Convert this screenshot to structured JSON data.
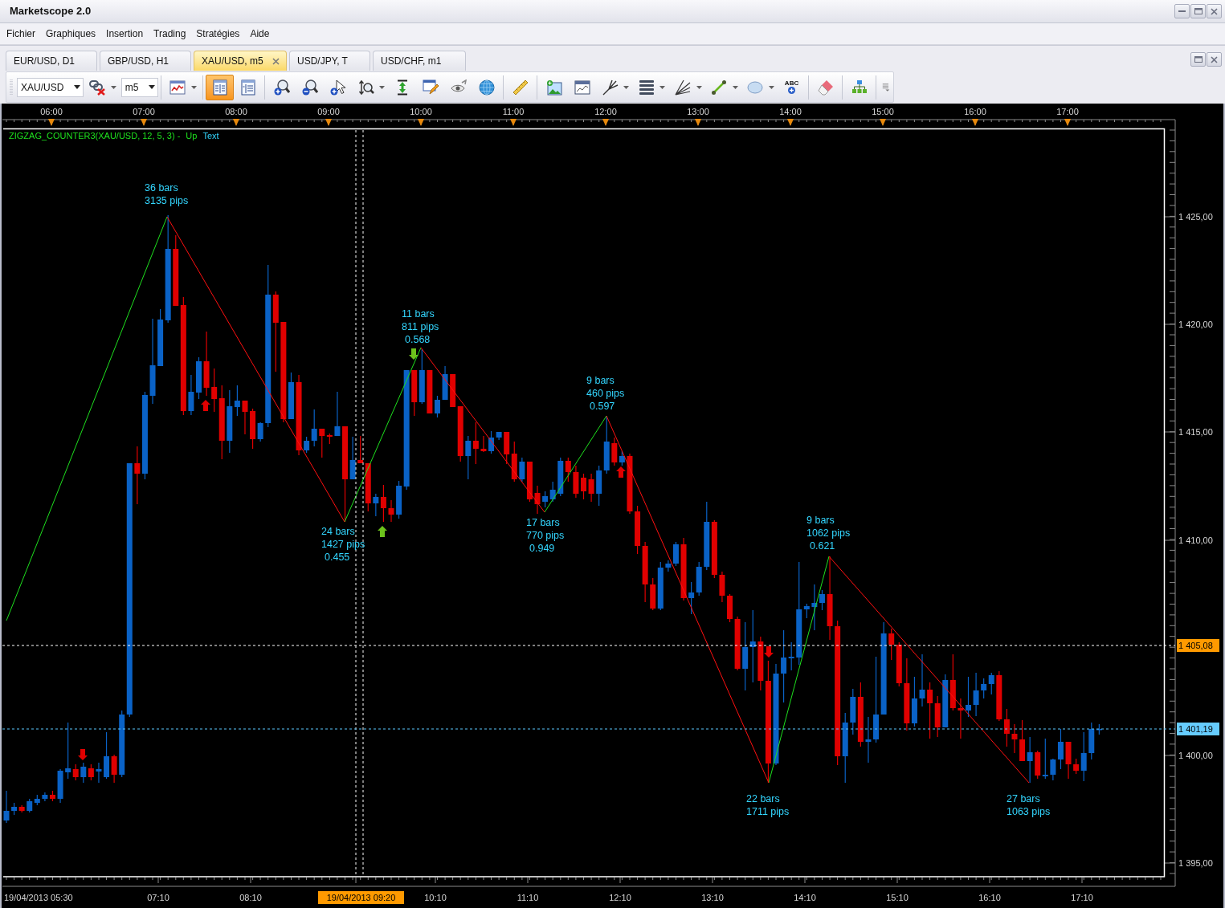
{
  "window": {
    "title": "Marketscope 2.0"
  },
  "menu": [
    "Fichier",
    "Graphiques",
    "Insertion",
    "Trading",
    "Stratégies",
    "Aide"
  ],
  "tabs": [
    {
      "label": "EUR/USD, D1",
      "selected": false
    },
    {
      "label": "GBP/USD, H1",
      "selected": false
    },
    {
      "label": "XAU/USD, m5",
      "selected": true
    },
    {
      "label": "USD/JPY, T",
      "selected": false
    },
    {
      "label": "USD/CHF, m1",
      "selected": false
    }
  ],
  "toolbar": {
    "symbol": "XAU/USD",
    "timeframe": "m5",
    "groups": [
      [
        {
          "kind": "link",
          "selected": false,
          "dropdown": true
        }
      ],
      [
        {
          "kind": "charttype",
          "selected": false,
          "dropdown": true
        }
      ],
      [
        {
          "kind": "layoutb",
          "selected": true,
          "dropdown": false
        },
        {
          "kind": "layouta",
          "selected": false,
          "dropdown": false
        }
      ],
      [
        {
          "kind": "zoomin",
          "selected": false,
          "dropdown": false
        },
        {
          "kind": "zoomout",
          "selected": false,
          "dropdown": false
        },
        {
          "kind": "pointer",
          "selected": false,
          "dropdown": false
        },
        {
          "kind": "zoomrange",
          "selected": false,
          "dropdown": true
        },
        {
          "kind": "cursor",
          "selected": false,
          "dropdown": false
        },
        {
          "kind": "properties",
          "selected": false,
          "dropdown": false
        },
        {
          "kind": "eye",
          "selected": false,
          "dropdown": false
        },
        {
          "kind": "globe",
          "selected": false,
          "dropdown": false
        }
      ],
      [
        {
          "kind": "ruler",
          "selected": false,
          "dropdown": false
        }
      ],
      [
        {
          "kind": "image",
          "selected": false,
          "dropdown": false
        },
        {
          "kind": "window",
          "selected": false,
          "dropdown": false
        },
        {
          "kind": "pitchfork",
          "selected": false,
          "dropdown": true
        },
        {
          "kind": "levels",
          "selected": false,
          "dropdown": true
        },
        {
          "kind": "fan",
          "selected": false,
          "dropdown": true
        },
        {
          "kind": "line",
          "selected": false,
          "dropdown": true
        },
        {
          "kind": "ellipse",
          "selected": false,
          "dropdown": true
        },
        {
          "kind": "text",
          "label": "ABC",
          "selected": false,
          "dropdown": false
        }
      ],
      [
        {
          "kind": "eraser",
          "selected": false,
          "dropdown": false
        }
      ],
      [
        {
          "kind": "hierarchy",
          "selected": false,
          "dropdown": false
        }
      ],
      [
        {
          "kind": "overflow",
          "selected": false,
          "dropdown": false
        }
      ]
    ]
  },
  "chart": {
    "legend": {
      "indicator": "ZIGZAG_COUNTER3(XAU/USD, 12, 5, 3) -",
      "line": "Up",
      "style": "Text"
    },
    "time_axis_top": [
      "06:00",
      "07:00",
      "08:00",
      "09:00",
      "10:00",
      "11:00",
      "12:00",
      "13:00",
      "14:00",
      "15:00",
      "16:00",
      "17:00"
    ],
    "time_axis_bottom": {
      "labels": [
        "19/04/2013 05:30",
        "07:10",
        "08:10",
        "10:10",
        "11:10",
        "12:10",
        "13:10",
        "14:10",
        "15:10",
        "16:10",
        "17:10"
      ],
      "cursor_label": "19/04/2013 09:20"
    },
    "price_axis": {
      "labels": [
        "1 425,00",
        "1 420,00",
        "1 415,00",
        "1 410,00",
        "1 400,00",
        "1 395,00"
      ],
      "cursor_label": "1 405,08",
      "last_price_label": "1 401,19"
    },
    "zigzag_labels": [
      {
        "bars": "36 bars",
        "pips": "3135 pips"
      },
      {
        "bars": "24 bars",
        "pips": "1427 pips",
        "ratio": "0.455"
      },
      {
        "bars": "11 bars",
        "pips": "811 pips",
        "ratio": "0.568"
      },
      {
        "bars": "17 bars",
        "pips": "770 pips",
        "ratio": "0.949"
      },
      {
        "bars": "9 bars",
        "pips": "460 pips",
        "ratio": "0.597"
      },
      {
        "bars": "22 bars",
        "pips": "1711 pips"
      },
      {
        "bars": "9 bars",
        "pips": "1062 pips",
        "ratio": "0.621"
      },
      {
        "bars": "27 bars",
        "pips": "1063 pips"
      }
    ]
  }
}
